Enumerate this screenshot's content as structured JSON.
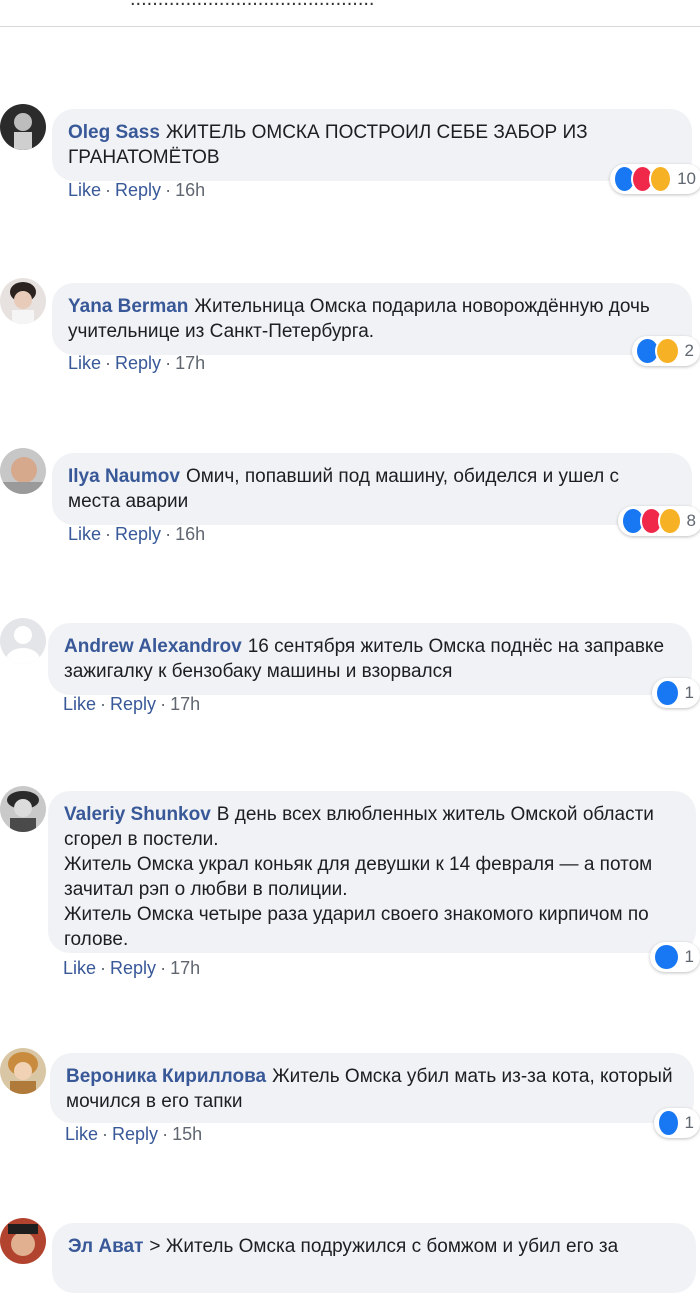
{
  "header": {
    "cut_text": "............................................"
  },
  "actions": {
    "like": "Like",
    "reply": "Reply",
    "dot": "·"
  },
  "comments": [
    {
      "author": "Oleg Sass",
      "text": "ЖИТЕЛЬ ОМСКА ПОСТРОИЛ СЕБЕ ЗАБОР ИЗ ГРАНАТОМЁТОВ",
      "time": "16h",
      "reaction_count": "10",
      "reactions": [
        "like-icon",
        "love-icon",
        "haha-icon"
      ]
    },
    {
      "author": "Yana Berman",
      "text": "Жительница Омска подарила новорождённую дочь учительнице из Санкт-Петербурга.",
      "time": "17h",
      "reaction_count": "2",
      "reactions": [
        "like-icon",
        "wow-icon"
      ]
    },
    {
      "author": "Ilya Naumov",
      "text": "Омич, попавший под машину, обиделся и ушел с места аварии",
      "time": "16h",
      "reaction_count": "8",
      "reactions": [
        "like-icon",
        "love-icon",
        "haha-icon"
      ]
    },
    {
      "author": "Andrew Alexandrov",
      "text": "16 сентября житель Омска поднёс на заправке зажигалку к бензобаку машины и взорвался",
      "time": "17h",
      "reaction_count": "1",
      "reactions": [
        "like-icon"
      ]
    },
    {
      "author": "Valeriy Shunkov",
      "text": "В день всех влюбленных житель Омской области сгорел в постели.\nЖитель Омска украл коньяк для девушки к 14 февраля — а потом зачитал рэп о любви в полиции.\nЖитель Омска четыре раза ударил своего знакомого кирпичом по голове.",
      "time": "17h",
      "reaction_count": "1",
      "reactions": [
        "like-icon"
      ]
    },
    {
      "author": "Вероника Кириллова",
      "text": "Житель Омска убил мать из-за кота, который мочился в его тапки",
      "time": "15h",
      "reaction_count": "1",
      "reactions": [
        "like-icon"
      ]
    },
    {
      "author": "Эл Ават",
      "text": "> Житель Омска подружился с бомжом и убил его за",
      "time": "",
      "reaction_count": "",
      "reactions": []
    }
  ]
}
